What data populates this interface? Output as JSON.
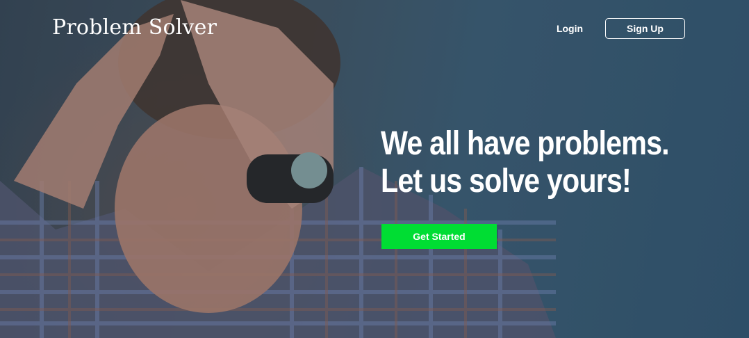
{
  "header": {
    "logo": "Problem Solver",
    "login_label": "Login",
    "signup_label": "Sign Up"
  },
  "hero": {
    "headline_line1": "We all have problems.",
    "headline_line2": "Let us solve yours!",
    "cta_label": "Get Started",
    "image": "stressed-man-holding-head-photo"
  },
  "colors": {
    "cta_background": "#00dd33",
    "text": "#ffffff",
    "background_blue": "#3f6178"
  }
}
